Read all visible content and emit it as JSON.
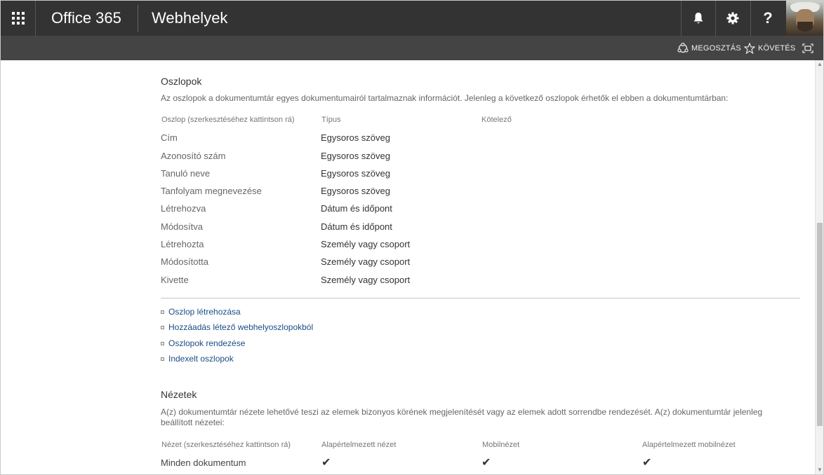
{
  "suitebar": {
    "brand": "Office 365",
    "app_title": "Webhelyek",
    "icons": [
      "app-launcher-icon",
      "bell-icon",
      "gear-icon",
      "help-icon"
    ],
    "help_glyph": "?"
  },
  "ribbon": {
    "share_label": "MEGOSZTÁS",
    "follow_label": "KÖVETÉS"
  },
  "columns_section": {
    "title": "Oszlopok",
    "description": "Az oszlopok a dokumentumtár egyes dokumentumairól tartalmaznak információt. Jelenleg a következő oszlopok érhetők el ebben a dokumentumtárban:",
    "headers": {
      "column": "Oszlop (szerkesztéséhez kattintson rá)",
      "type": "Típus",
      "required": "Kötelező"
    },
    "rows": [
      {
        "name": "Cím",
        "type": "Egysoros szöveg"
      },
      {
        "name": "Azonosító szám",
        "type": "Egysoros szöveg"
      },
      {
        "name": "Tanuló neve",
        "type": "Egysoros szöveg"
      },
      {
        "name": "Tanfolyam megnevezése",
        "type": "Egysoros szöveg"
      },
      {
        "name": "Létrehozva",
        "type": "Dátum és időpont"
      },
      {
        "name": "Módosítva",
        "type": "Dátum és időpont"
      },
      {
        "name": "Létrehozta",
        "type": "Személy vagy csoport"
      },
      {
        "name": "Módosította",
        "type": "Személy vagy csoport"
      },
      {
        "name": "Kivette",
        "type": "Személy vagy csoport"
      }
    ],
    "links": [
      "Oszlop létrehozása",
      "Hozzáadás létező webhelyoszlopokból",
      "Oszlopok rendezése",
      "Indexelt oszlopok"
    ]
  },
  "views_section": {
    "title": "Nézetek",
    "description": "A(z) dokumentumtár nézete lehetővé teszi az elemek bizonyos körének megjelenítését vagy az elemek adott sorrendbe rendezését. A(z) dokumentumtár jelenleg beállított nézetei:",
    "headers": {
      "view": "Nézet (szerkesztéséhez kattintson rá)",
      "default_view": "Alapértelmezett nézet",
      "mobile_view": "Mobilnézet",
      "default_mobile_view": "Alapértelmezett mobilnézet"
    },
    "rows": [
      {
        "name": "Minden dokumentum",
        "default_view": true,
        "mobile_view": true,
        "default_mobile_view": true
      }
    ],
    "check_glyph": "✔"
  }
}
